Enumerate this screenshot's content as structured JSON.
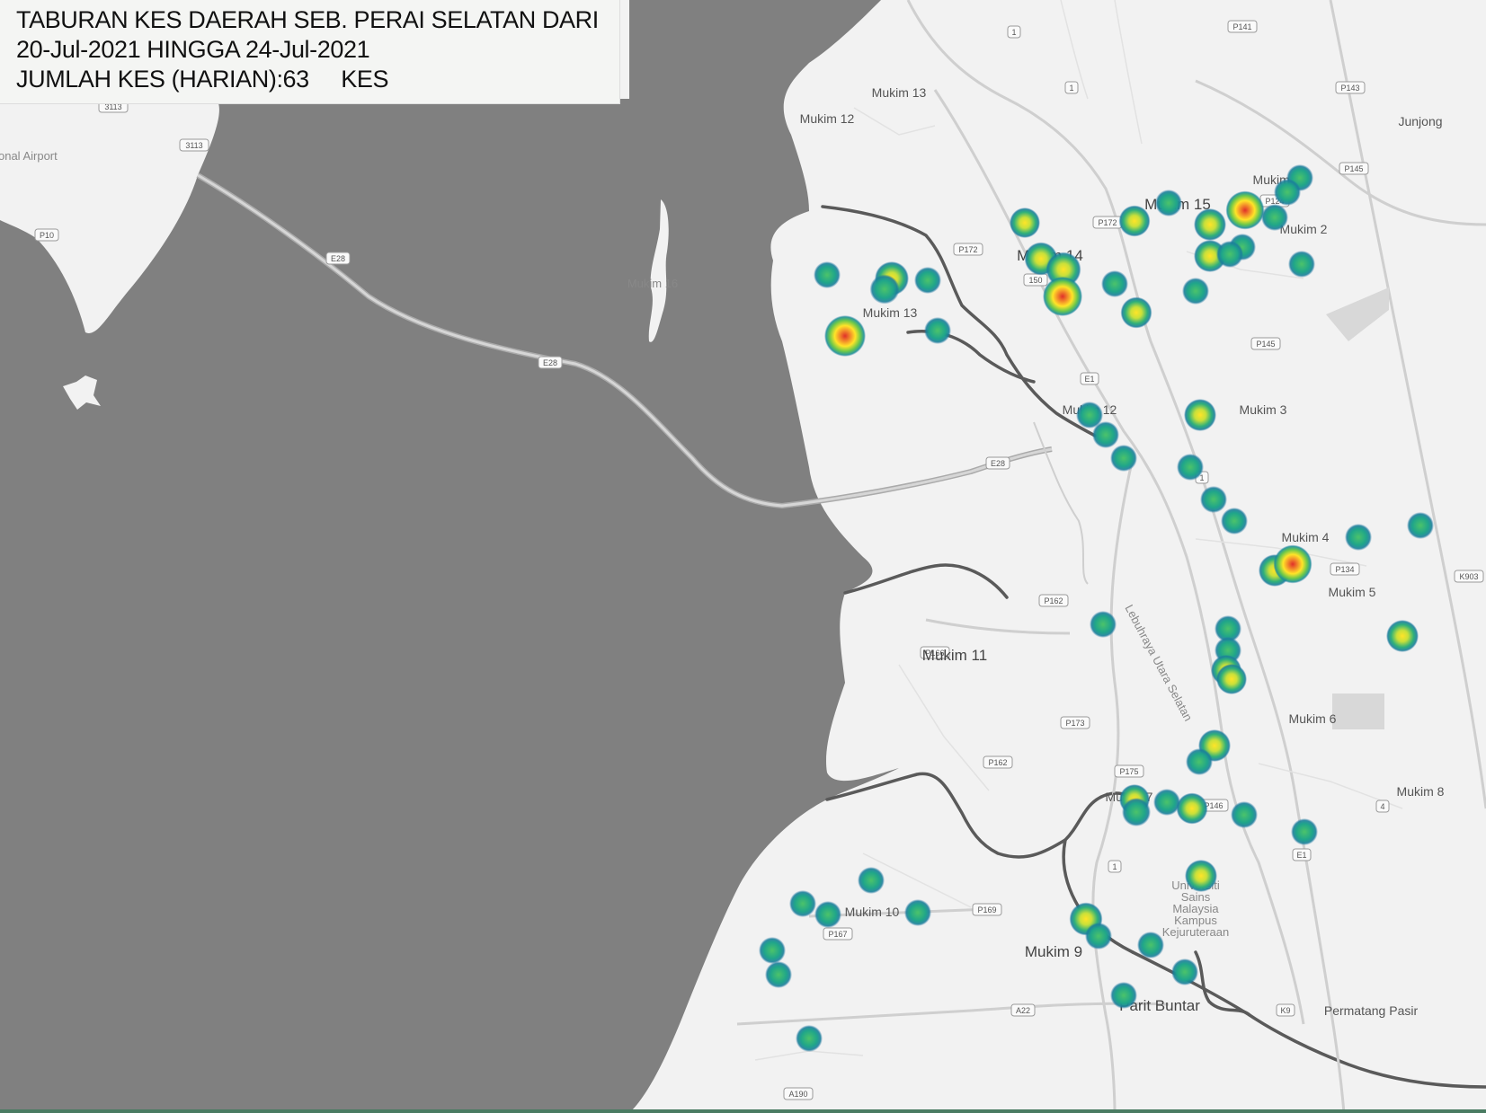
{
  "header": {
    "line1": "TABURAN KES DAERAH SEB. PERAI SELATAN DARI",
    "line2": "20-Jul-2021 HINGGA 24-Jul-2021",
    "line3": "JUMLAH KES (HARIAN):63     KES"
  },
  "colors": {
    "water": "#808080",
    "land": "#f2f2f2",
    "road": "#cfcfcf",
    "river": "#5a5a5a",
    "heat_low": "#1a9a8a",
    "heat_mid": "#9cd43b",
    "heat_high": "#ffe428",
    "heat_peak": "#e0302a",
    "bottom_bar": "#4a7b62"
  },
  "map_labels": [
    {
      "key": "mukim13_n",
      "text": "Mukim 13"
    },
    {
      "key": "mukim12_n",
      "text": "Mukim 12"
    },
    {
      "key": "mukim1",
      "text": "Mukim 1"
    },
    {
      "key": "mukim15",
      "text": "Mukim 15"
    },
    {
      "key": "mukim2",
      "text": "Mukim 2"
    },
    {
      "key": "mukim14",
      "text": "Mukim 14"
    },
    {
      "key": "mukim16",
      "text": "Mukim 16"
    },
    {
      "key": "mukim13_s",
      "text": "Mukim 13"
    },
    {
      "key": "mukim12_s",
      "text": "Mukim 12"
    },
    {
      "key": "mukim3",
      "text": "Mukim 3"
    },
    {
      "key": "mukim4",
      "text": "Mukim 4"
    },
    {
      "key": "mukim5",
      "text": "Mukim 5"
    },
    {
      "key": "mukim11",
      "text": "Mukim 11"
    },
    {
      "key": "mukim6",
      "text": "Mukim 6"
    },
    {
      "key": "mukim7",
      "text": "Mukim 7"
    },
    {
      "key": "mukim8",
      "text": "Mukim 8"
    },
    {
      "key": "mukim10",
      "text": "Mukim 10"
    },
    {
      "key": "mukim9",
      "text": "Mukim 9"
    },
    {
      "key": "parit_buntar",
      "text": "Parit Buntar"
    },
    {
      "key": "permatang_pasir",
      "text": "Permatang Pasir"
    },
    {
      "key": "junjong",
      "text": "Junjong"
    },
    {
      "key": "usm",
      "text": "Universiti Sains Malaysia Kampus Kejuruteraan"
    },
    {
      "key": "airport",
      "text": "ational Airport"
    },
    {
      "key": "lebuhraya",
      "text": "Lebuhraya Utara Selatan"
    }
  ],
  "road_shields": [
    "1",
    "1",
    "P141",
    "P143",
    "P145",
    "P124",
    "P172",
    "P172",
    "150",
    "E1",
    "P145",
    "1",
    "E28",
    "E28",
    "E28",
    "P134",
    "K903",
    "P162",
    "P166",
    "P173",
    "P162",
    "P175",
    "P146",
    "E1",
    "4",
    "1",
    "P169",
    "P167",
    "A22",
    "K9",
    "A190",
    "P10",
    "3113",
    "3113"
  ],
  "heat_points": [
    {
      "area": "Mukim 13",
      "intensity": 0.2
    },
    {
      "area": "Mukim 13",
      "intensity": 0.6
    },
    {
      "area": "Mukim 13",
      "intensity": 0.35
    },
    {
      "area": "Mukim 13",
      "intensity": 0.2
    },
    {
      "area": "Mukim 13",
      "intensity": 1.0
    },
    {
      "area": "Mukim 13",
      "intensity": 0.2
    },
    {
      "area": "Mukim 14",
      "intensity": 0.4
    },
    {
      "area": "Mukim 14",
      "intensity": 0.55
    },
    {
      "area": "Mukim 14",
      "intensity": 0.65
    },
    {
      "area": "Mukim 14",
      "intensity": 0.9
    },
    {
      "area": "Mukim 14",
      "intensity": 0.2
    },
    {
      "area": "Mukim 14",
      "intensity": 0.45
    },
    {
      "area": "Mukim 15",
      "intensity": 0.45
    },
    {
      "area": "Mukim 15",
      "intensity": 0.2
    },
    {
      "area": "Mukim 15",
      "intensity": 0.5
    },
    {
      "area": "Mukim 15",
      "intensity": 0.85
    },
    {
      "area": "Mukim 15",
      "intensity": 0.2
    },
    {
      "area": "Mukim 15",
      "intensity": 0.5
    },
    {
      "area": "Mukim 15",
      "intensity": 0.2
    },
    {
      "area": "Mukim 15",
      "intensity": 0.2
    },
    {
      "area": "Mukim 15",
      "intensity": 0.2
    },
    {
      "area": "Mukim 1",
      "intensity": 0.2
    },
    {
      "area": "Mukim 1",
      "intensity": 0.2
    },
    {
      "area": "Mukim 2",
      "intensity": 0.2
    },
    {
      "area": "Mukim 12",
      "intensity": 0.2
    },
    {
      "area": "Mukim 12",
      "intensity": 0.5
    },
    {
      "area": "Mukim 12",
      "intensity": 0.2
    },
    {
      "area": "Mukim 12",
      "intensity": 0.2
    },
    {
      "area": "Mukim 3",
      "intensity": 0.2
    },
    {
      "area": "Mukim 3",
      "intensity": 0.2
    },
    {
      "area": "Mukim 3",
      "intensity": 0.2
    },
    {
      "area": "Mukim 4",
      "intensity": 0.5
    },
    {
      "area": "Mukim 4",
      "intensity": 0.85
    },
    {
      "area": "Mukim 4",
      "intensity": 0.2
    },
    {
      "area": "Mukim 4",
      "intensity": 0.2
    },
    {
      "area": "Mukim 5",
      "intensity": 0.5
    },
    {
      "area": "Mukim 11",
      "intensity": 0.2
    },
    {
      "area": "Mukim 6",
      "intensity": 0.2
    },
    {
      "area": "Mukim 6",
      "intensity": 0.2
    },
    {
      "area": "Mukim 6",
      "intensity": 0.4
    },
    {
      "area": "Mukim 6",
      "intensity": 0.4
    },
    {
      "area": "Mukim 6",
      "intensity": 0.5
    },
    {
      "area": "Mukim 6",
      "intensity": 0.2
    },
    {
      "area": "Mukim 7",
      "intensity": 0.4
    },
    {
      "area": "Mukim 7",
      "intensity": 0.3
    },
    {
      "area": "Mukim 7",
      "intensity": 0.2
    },
    {
      "area": "Mukim 7",
      "intensity": 0.45
    },
    {
      "area": "Mukim 7",
      "intensity": 0.2
    },
    {
      "area": "Mukim 7",
      "intensity": 0.2
    },
    {
      "area": "Mukim 7",
      "intensity": 0.5
    },
    {
      "area": "Mukim 10",
      "intensity": 0.2
    },
    {
      "area": "Mukim 10",
      "intensity": 0.2
    },
    {
      "area": "Mukim 10",
      "intensity": 0.2
    },
    {
      "area": "Mukim 10",
      "intensity": 0.2
    },
    {
      "area": "Mukim 10",
      "intensity": 0.2
    },
    {
      "area": "Mukim 10",
      "intensity": 0.2
    },
    {
      "area": "Mukim 10",
      "intensity": 0.2
    },
    {
      "area": "Mukim 9",
      "intensity": 0.55
    },
    {
      "area": "Mukim 9",
      "intensity": 0.2
    },
    {
      "area": "Mukim 9",
      "intensity": 0.2
    },
    {
      "area": "Mukim 9",
      "intensity": 0.2
    },
    {
      "area": "Mukim 9",
      "intensity": 0.2
    }
  ]
}
